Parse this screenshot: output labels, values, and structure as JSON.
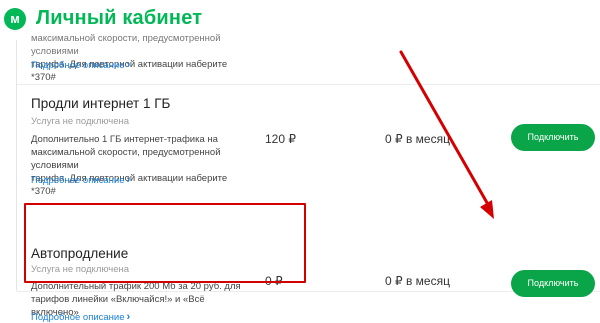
{
  "header": {
    "logo_letter": "м",
    "title": "Личный кабинет"
  },
  "cards": [
    {
      "desc_lines": [
        "максимальной скорости, предусмотренной условиями",
        "тарифа. Для повторной активации наберите *370#"
      ],
      "more_label": "Подробное описание"
    },
    {
      "title": "Продли интернет 1 ГБ",
      "status": "Услуга не подключена",
      "desc_lines": [
        "Дополнительно 1 ГБ интернет-трафика на",
        "максимальной скорости, предусмотренной условиями",
        "тарифа. Для повторной активации наберите *370#"
      ],
      "more_label": "Подробное описание",
      "price": "120 ₽",
      "monthly": "0 ₽ в месяц",
      "button_label": "Подключить"
    },
    {
      "title": "Автопродление",
      "status": "Услуга не подключена",
      "desc_lines": [
        "Дополнительный трафик 200 Мб за 20 руб. для",
        "тарифов линейки «Включайся!» и «Всё включено»"
      ],
      "more_label": "Подробное описание",
      "price": "0 ₽",
      "monthly": "0 ₽ в месяц",
      "button_label": "Подключить"
    }
  ],
  "icons": {
    "more_chevron": "chevron-right-icon",
    "arrow": "red-arrow-annotation"
  },
  "colors": {
    "brand_green": "#00b956",
    "button_green": "#0aa549",
    "link_blue": "#1c7fd8",
    "annotation_red": "#d40000"
  }
}
